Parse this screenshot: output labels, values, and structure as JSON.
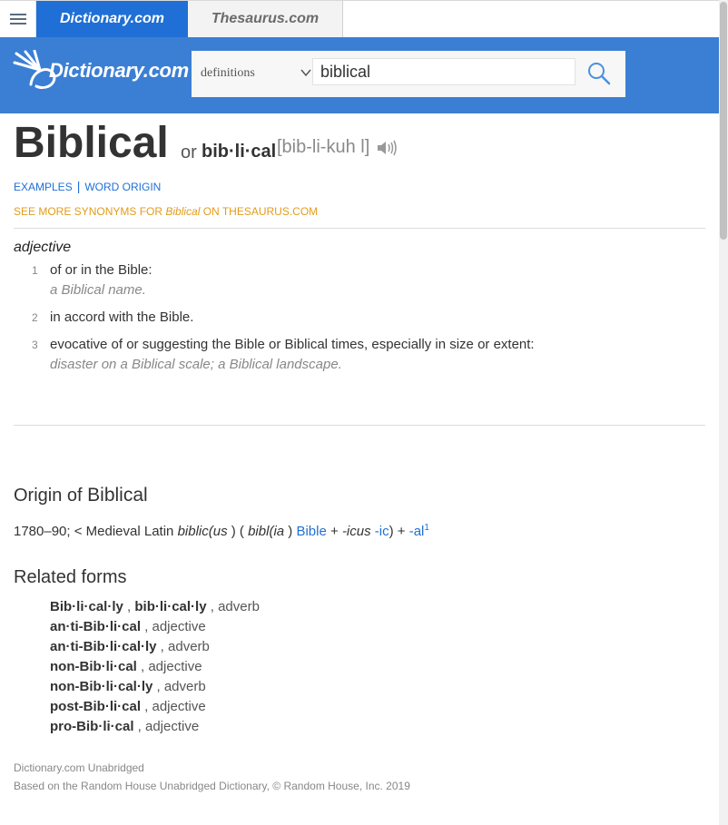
{
  "tabs": [
    {
      "label": "Dictionary.com",
      "active": true
    },
    {
      "label": "Thesaurus.com",
      "active": false
    }
  ],
  "header": {
    "logo_text": "Dictionary.com",
    "search_type": "definitions",
    "search_value": "biblical"
  },
  "entry": {
    "headword": "Biblical",
    "or_label": "or",
    "variant": "bib·li·cal",
    "pronunciation": "[bib-li-kuh l]",
    "links": {
      "examples": "EXAMPLES",
      "word_origin": "WORD ORIGIN"
    },
    "synonyms_link": {
      "prefix": "SEE MORE SYNONYMS FOR ",
      "word": "Biblical",
      "suffix": " ON THESAURUS.COM"
    },
    "part_of_speech": "adjective",
    "definitions": [
      {
        "num": "1",
        "text": "of or in the Bible:",
        "example": "a Biblical name."
      },
      {
        "num": "2",
        "text": "in accord with the Bible.",
        "example": ""
      },
      {
        "num": "3",
        "text": "evocative of or suggesting the Bible or Biblical times, especially in size or extent:",
        "example": "disaster on a Biblical scale; a Biblical landscape."
      }
    ]
  },
  "origin": {
    "heading_prefix": "Origin of ",
    "heading_word": "Biblical",
    "date": "1780–90; < Medieval Latin ",
    "latin": "biblic(us",
    "paren_open": " ) ( ",
    "bibl": "bibl(ia",
    "paren_close": " ) ",
    "bible_link": "Bible",
    "plus1": " + ",
    "icus": "-icus",
    "ic_link": "-ic",
    "plus2": ") + ",
    "al_link": "-al",
    "al_sup": "1"
  },
  "related": {
    "heading": "Related forms",
    "forms": [
      {
        "word": "Bib·li·cal·ly",
        "sep": " , ",
        "word2": "bib·li·cal·ly",
        "pos": " , adverb"
      },
      {
        "word": "an·ti-Bib·li·cal",
        "pos": " , adjective"
      },
      {
        "word": "an·ti-Bib·li·cal·ly",
        "pos": " , adverb"
      },
      {
        "word": "non-Bib·li·cal",
        "pos": " , adjective"
      },
      {
        "word": "non-Bib·li·cal·ly",
        "pos": " , adverb"
      },
      {
        "word": "post-Bib·li·cal",
        "pos": " , adjective"
      },
      {
        "word": "pro-Bib·li·cal",
        "pos": " , adjective"
      }
    ]
  },
  "source": {
    "line1": "Dictionary.com Unabridged",
    "line2": "Based on the Random House Unabridged Dictionary, © Random House, Inc. 2019"
  },
  "colors": {
    "brand_blue": "#3b7fd4",
    "tab_blue": "#1f6fd6",
    "link": "#1f6fd6",
    "synonym_orange": "#e39b1b"
  },
  "icons": [
    "menu-icon",
    "logo-rays-icon",
    "chevron-down-icon",
    "search-icon",
    "audio-icon"
  ]
}
